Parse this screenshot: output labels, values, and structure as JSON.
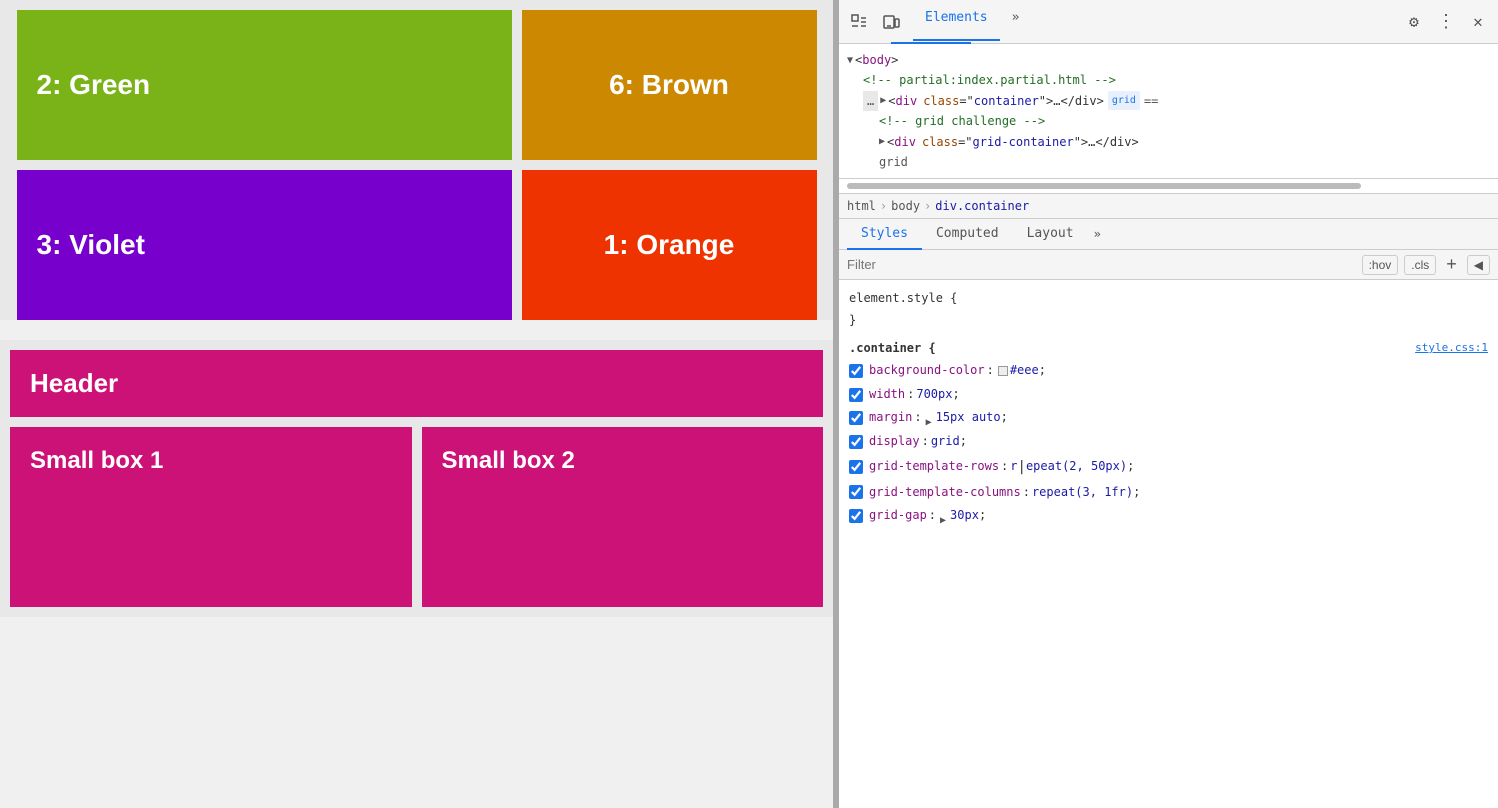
{
  "left": {
    "boxes": {
      "green": {
        "label": "2: Green"
      },
      "brown": {
        "label": "6: Brown"
      },
      "violet": {
        "label": "3: Violet"
      },
      "orange": {
        "label": "1: Orange"
      },
      "header": {
        "label": "Header"
      },
      "small1": {
        "label": "Small box 1"
      },
      "small2": {
        "label": "Small box 2"
      }
    }
  },
  "devtools": {
    "toolbar": {
      "inspect_label": "⬚",
      "device_label": "⬚",
      "elements_tab": "Elements",
      "more_tabs": "»",
      "settings_label": "⚙",
      "menu_label": "⋮",
      "close_label": "✕"
    },
    "html_tree": {
      "body_tag": "<body>",
      "comment1": "<!-- partial:index.partial.html -->",
      "div_container": "<div class=\"container\">…</div>",
      "badge_grid": "grid",
      "eq_badge": "==",
      "comment2": "<!-- grid challenge -->",
      "div_grid_container": "<div class=\"grid-container\">…</div>"
    },
    "breadcrumbs": [
      "html",
      "body",
      "div.container"
    ],
    "style_tabs": [
      "Styles",
      "Computed",
      "Layout",
      "»"
    ],
    "filter": {
      "placeholder": "Filter",
      "hov_label": ":hov",
      "cls_label": ".cls"
    },
    "css_rules": {
      "element_style_header": "element.style {",
      "element_style_close": "}",
      "container_header": ".container {",
      "container_source": "style.css:1",
      "properties": [
        {
          "checked": true,
          "name": "background-color",
          "value": "#eee",
          "has_swatch": true,
          "swatch_color": "#eeeeee"
        },
        {
          "checked": true,
          "name": "width",
          "value": "700px"
        },
        {
          "checked": true,
          "name": "margin",
          "value": "▶ 15px auto",
          "has_expand": true
        },
        {
          "checked": true,
          "name": "display",
          "value": "grid"
        },
        {
          "checked": true,
          "name": "grid-template-rows",
          "value": "repeat(2, 50px)",
          "has_cursor": true
        },
        {
          "checked": true,
          "name": "grid-template-columns",
          "value": "repeat(3, 1fr)"
        },
        {
          "checked": true,
          "name": "grid-gap",
          "value": "▶ 30px",
          "has_expand": true
        }
      ]
    }
  }
}
